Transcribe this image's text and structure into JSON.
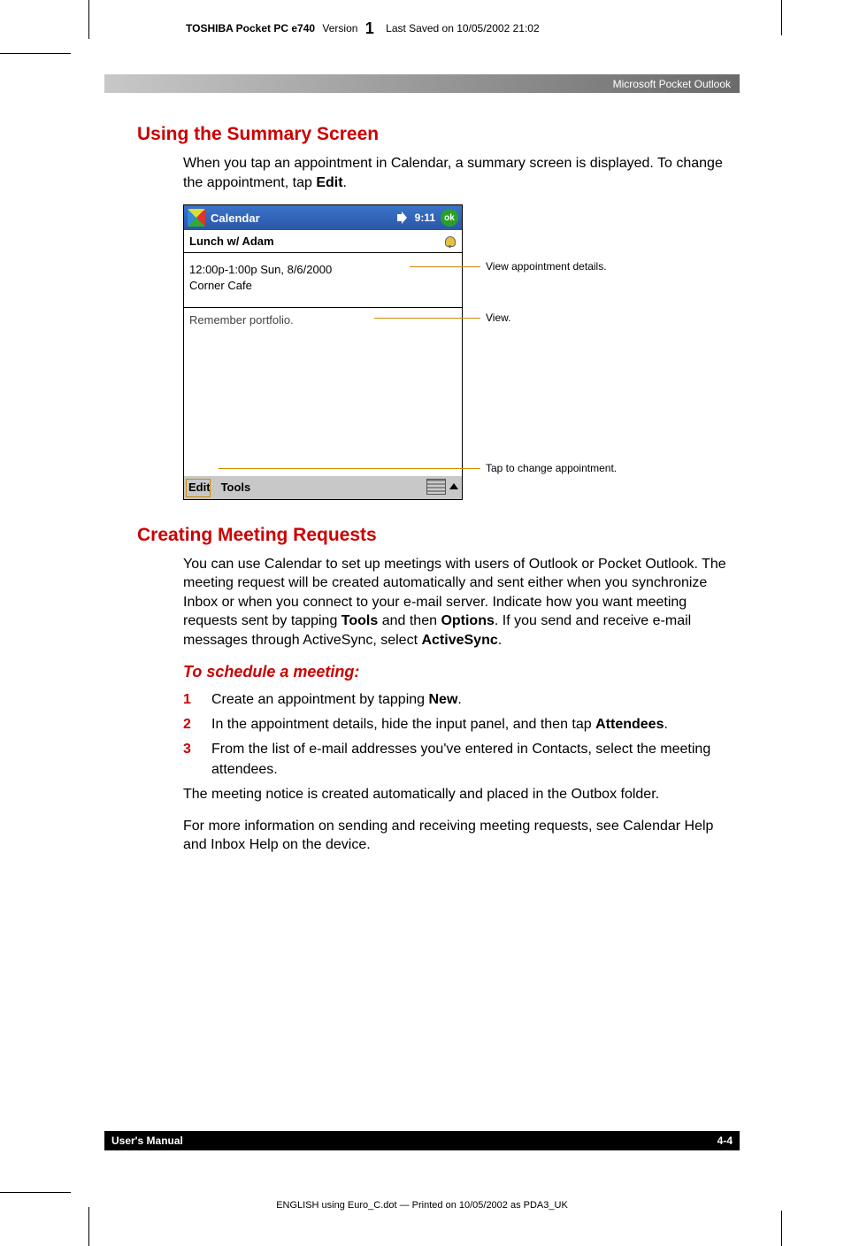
{
  "running_head": {
    "product_bold": "TOSHIBA Pocket PC e740",
    "version_label": "Version",
    "version_digit": "1",
    "saved": "Last Saved on 10/05/2002 21:02"
  },
  "chapter_banner": "Microsoft Pocket Outlook",
  "h1": "Using the Summary Screen",
  "intro": {
    "text_before": "When you tap an appointment in Calendar, a summary screen is displayed. To change the appointment, tap ",
    "bold": "Edit",
    "after": "."
  },
  "screenshot": {
    "titlebar": {
      "app": "Calendar",
      "time": "9:11",
      "ok": "ok"
    },
    "subject": "Lunch w/ Adam",
    "detail_line1": "12:00p-1:00p Sun, 8/6/2000",
    "detail_line2": "Corner Cafe",
    "notes": "Remember portfolio.",
    "menu_edit": "Edit",
    "menu_tools": "Tools"
  },
  "callouts": {
    "details": "View appointment details.",
    "view": "View.",
    "change": "Tap to change appointment."
  },
  "h2": "Creating Meeting Requests",
  "para2": {
    "t1": "You can use Calendar to set up meetings with users of Outlook or Pocket Outlook. The meeting request will be created automatically and sent either when you synchronize Inbox or when you connect to your e-mail server. Indicate how you want meeting requests sent by tapping ",
    "b1": "Tools",
    "t2": " and then ",
    "b2": "Options",
    "t3": ". If you send and receive e-mail messages through ActiveSync, select ",
    "b3": "ActiveSync",
    "t4": "."
  },
  "h3": "To schedule a meeting:",
  "steps": [
    {
      "num": "1",
      "before": "Create an appointment by tapping ",
      "bold": "New",
      "after": "."
    },
    {
      "num": "2",
      "before": "In the appointment details, hide the input panel, and then tap ",
      "bold": "Attendees",
      "after": "."
    },
    {
      "num": "3",
      "before": "From the list of e-mail addresses you've entered in Contacts, select the meeting attendees.",
      "bold": "",
      "after": ""
    }
  ],
  "para3": "The meeting notice is created automatically and placed in the Outbox folder.",
  "para4": "For more information on sending and receiving meeting requests, see Calendar Help and Inbox Help on the device.",
  "footer": {
    "left": "User's Manual",
    "right": "4-4"
  },
  "bottom_note": "ENGLISH using  Euro_C.dot — Printed on 10/05/2002 as PDA3_UK"
}
